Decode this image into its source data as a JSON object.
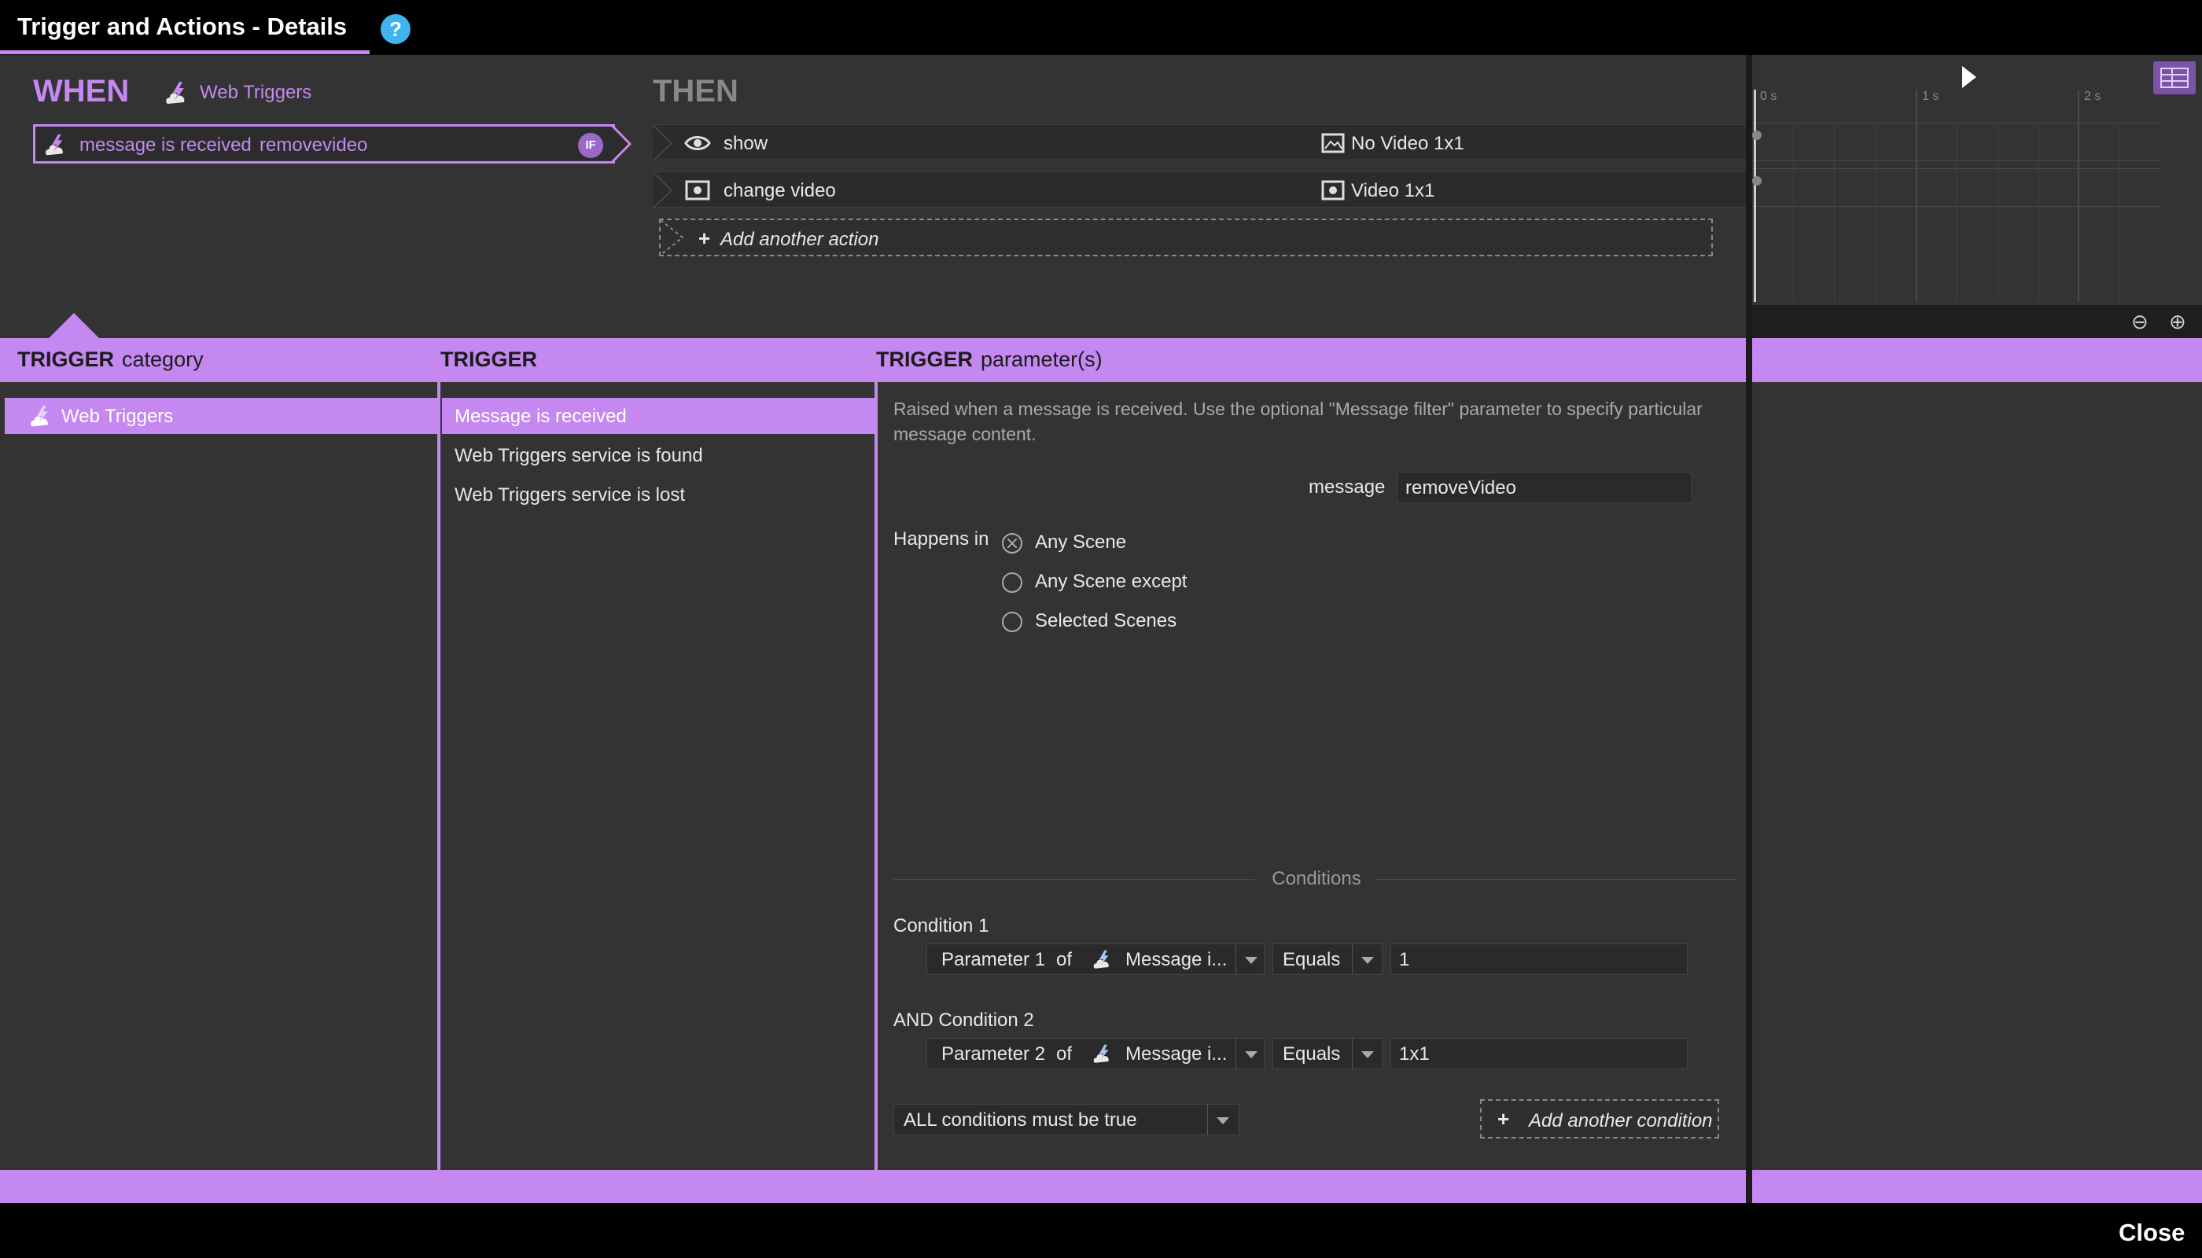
{
  "window": {
    "title": "Trigger and Actions - Details",
    "help_icon": "?",
    "close_label": "Close"
  },
  "when": {
    "label": "WHEN",
    "category_label": "Web Triggers",
    "category_icon": "web-triggers-icon",
    "trigger_text": "message is received",
    "trigger_value": "removevideo",
    "if_badge": "IF"
  },
  "then": {
    "label": "THEN",
    "actions": [
      {
        "icon": "eye-icon",
        "name": "show",
        "target_icon": "image-icon",
        "target": "No Video 1x1"
      },
      {
        "icon": "video-icon",
        "name": "change video",
        "target_icon": "video-icon",
        "target": "Video 1x1"
      }
    ],
    "add_action_label": "Add another action"
  },
  "timeline": {
    "ruler": [
      "0 s",
      "1 s",
      "2 s"
    ]
  },
  "headers": {
    "category_bold": "TRIGGER",
    "category_rest": "category",
    "trigger_bold": "TRIGGER",
    "params_bold": "TRIGGER",
    "params_rest": "parameter(s)"
  },
  "categories": [
    {
      "label": "Web Triggers",
      "icon": "web-triggers-icon",
      "selected": true
    }
  ],
  "triggers": [
    {
      "label": "Message is received",
      "selected": true
    },
    {
      "label": "Web Triggers service is found",
      "selected": false
    },
    {
      "label": "Web Triggers service is lost",
      "selected": false
    }
  ],
  "params": {
    "description": "Raised when a message is received. Use the optional \"Message filter\" parameter to specify particular message content.",
    "message_label": "message",
    "message_value": "removeVideo",
    "happens_in_label": "Happens in",
    "scene_options": [
      {
        "label": "Any Scene",
        "checked": true
      },
      {
        "label": "Any Scene except",
        "checked": false
      },
      {
        "label": "Selected Scenes",
        "checked": false
      }
    ]
  },
  "conditions": {
    "title": "Conditions",
    "items": [
      {
        "label": "Condition 1",
        "param": "Parameter 1",
        "of": "of",
        "source": "Message i...",
        "operator": "Equals",
        "value": "1"
      },
      {
        "label": "AND Condition 2",
        "param": "Parameter 2",
        "of": "of",
        "source": "Message i...",
        "operator": "Equals",
        "value": "1x1"
      }
    ],
    "mode": "ALL conditions must be true",
    "add_condition_label": "Add another condition"
  },
  "colors": {
    "accent": "#c488f0",
    "help": "#3fb4ee",
    "panel": "#333333"
  }
}
